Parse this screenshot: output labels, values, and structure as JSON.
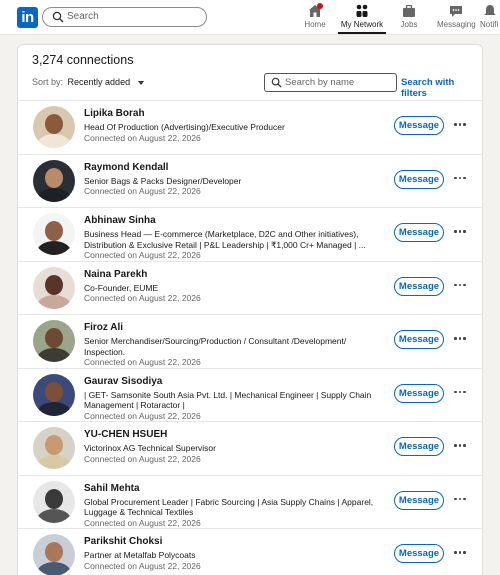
{
  "nav": {
    "logo": "in",
    "search_placeholder": "Search",
    "items": [
      {
        "label": "Home",
        "icon": "home-icon"
      },
      {
        "label": "My Network",
        "icon": "network-icon"
      },
      {
        "label": "Jobs",
        "icon": "briefcase-icon"
      },
      {
        "label": "Messaging",
        "icon": "chat-icon"
      },
      {
        "label": "Notifi",
        "icon": "bell-icon"
      }
    ]
  },
  "connections": {
    "count_label": "3,274 connections",
    "sort_label": "Sort by:",
    "sort_value": "Recently added",
    "search_placeholder": "Search by name",
    "filters_label": "Search with filters",
    "message_label": "Message",
    "items": [
      {
        "name": "Lipika Borah",
        "headline": "Head Of Production (Advertising)/Executive Producer",
        "connected": "Connected on August 22, 2026"
      },
      {
        "name": "Raymond Kendall",
        "headline": "Senior Bags & Packs Designer/Developer",
        "connected": "Connected on August 22, 2026"
      },
      {
        "name": "Abhinaw Sinha",
        "headline": "Business Head — E-commerce (Marketplace, D2C and Other initiatives), Distribution & Exclusive Retail | P&L Leadership | ₹1,000 Cr+ Managed | ...",
        "connected": "Connected on August 22, 2026"
      },
      {
        "name": "Naina Parekh",
        "headline": "Co-Founder, EUME",
        "connected": "Connected on August 22, 2026"
      },
      {
        "name": "Firoz Ali",
        "headline": "Senior Merchandiser/Sourcing/Production / Consultant /Development/ Inspection.",
        "connected": "Connected on August 22, 2026"
      },
      {
        "name": "Gaurav Sisodiya",
        "headline": "| GET- Samsonite South Asia Pvt. Ltd. | Mechanical Engineer | Supply Chain Management | Rotaractor |",
        "connected": "Connected on August 22, 2026"
      },
      {
        "name": "YU-CHEN HSUEH",
        "headline": "Victorinox AG Technical Supervisor",
        "connected": "Connected on August 22, 2026"
      },
      {
        "name": "Sahil Mehta",
        "headline": "Global Procurement Leader | Fabric Sourcing | Asia Supply Chains | Apparel, Luggage & Technical Textiles",
        "connected": "Connected on August 22, 2026"
      },
      {
        "name": "Parikshit Choksi",
        "headline": "Partner at Metalfab Polycoats",
        "connected": "Connected on August 22, 2026"
      }
    ]
  },
  "colors": {
    "brand": "#0a66c2",
    "notification": "#cc1016"
  }
}
